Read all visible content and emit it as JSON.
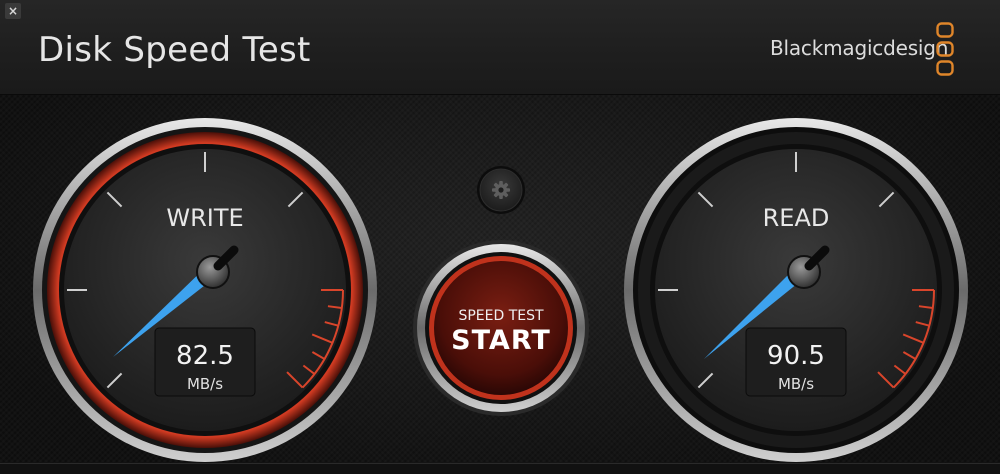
{
  "window": {
    "close_glyph": "×",
    "title": "Disk Speed Test",
    "brand": "Blackmagicdesign"
  },
  "write_gauge": {
    "label": "WRITE",
    "value": "82.5",
    "unit": "MB/s",
    "accent": "#c93a22"
  },
  "read_gauge": {
    "label": "READ",
    "value": "90.5",
    "unit": "MB/s",
    "accent": "#c93a22"
  },
  "settings": {
    "icon": "gear-icon"
  },
  "start_button": {
    "line1": "SPEED TEST",
    "line2": "START"
  },
  "colors": {
    "needle": "#3da2ee",
    "logo_orange": "#e0862a",
    "redline": "#d9452b"
  }
}
